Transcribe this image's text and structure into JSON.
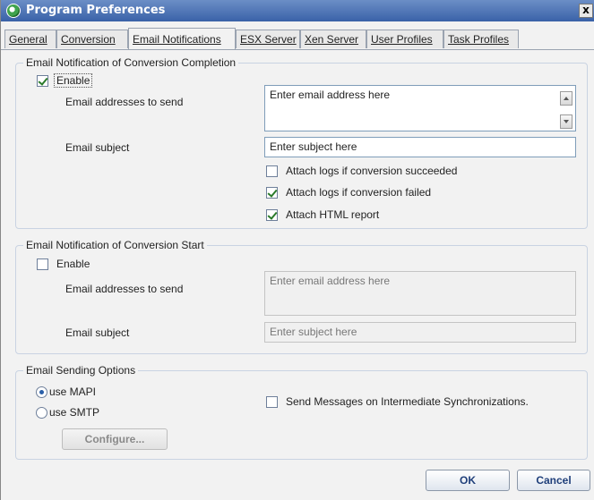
{
  "window": {
    "title": "Program Preferences",
    "close_glyph": "x"
  },
  "tabs": [
    {
      "label": "General",
      "active": false
    },
    {
      "label": "Conversion",
      "active": false
    },
    {
      "label": "Email Notifications",
      "active": true
    },
    {
      "label": "ESX Server",
      "active": false
    },
    {
      "label": "Xen Server",
      "active": false
    },
    {
      "label": "User Profiles",
      "active": false
    },
    {
      "label": "Task Profiles",
      "active": false
    }
  ],
  "completion": {
    "title": "Email Notification of Conversion Completion",
    "enable_label": "Enable",
    "enabled": true,
    "addresses_label": "Email addresses to send",
    "addresses_placeholder": "Enter email address here",
    "subject_label": "Email subject",
    "subject_placeholder": "Enter subject here",
    "attach_success_label": "Attach logs if conversion succeeded",
    "attach_success": false,
    "attach_failed_label": "Attach logs if conversion failed",
    "attach_failed": true,
    "attach_html_label": "Attach HTML report",
    "attach_html": true
  },
  "start": {
    "title": "Email Notification of Conversion Start",
    "enable_label": "Enable",
    "enabled": false,
    "addresses_label": "Email addresses to send",
    "addresses_placeholder": "Enter email address here",
    "subject_label": "Email subject",
    "subject_placeholder": "Enter subject here"
  },
  "sending": {
    "title": "Email Sending Options",
    "mapi_label": "use MAPI",
    "smtp_label": "use SMTP",
    "selected": "MAPI",
    "intermediate_label": "Send Messages on Intermediate Synchronizations.",
    "intermediate": false,
    "configure_label": "Configure..."
  },
  "buttons": {
    "ok": "OK",
    "cancel": "Cancel"
  },
  "colors": {
    "titlebar": "#3a62a8",
    "group_border": "#c9d3e2",
    "window_bg": "#f2f2f2"
  }
}
